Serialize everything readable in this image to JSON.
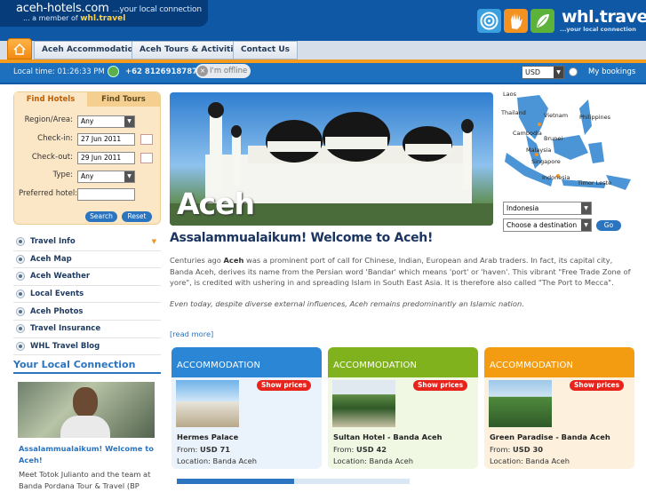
{
  "header": {
    "site_name": "aceh-hotels.com",
    "tagline": "...your local connection",
    "member_prefix": "... a member of",
    "member_brand": "whl.travel",
    "whl_logo": "whl.travel",
    "whl_tagline": "...your local connection"
  },
  "nav": {
    "items": [
      "Aceh Accommodation",
      "Aceh Tours & Activities",
      "Contact Us"
    ]
  },
  "infobar": {
    "local_time": "Local time: 01:26:33 PM",
    "phone": "+62 8126918787",
    "status": "I'm offline",
    "currency": "USD",
    "bookings": "My bookings"
  },
  "search": {
    "tabs": [
      "Find Hotels",
      "Find Tours"
    ],
    "region_label": "Region/Area:",
    "region_value": "Any",
    "checkin_label": "Check-in:",
    "checkin_value": "27 Jun 2011",
    "checkout_label": "Check-out:",
    "checkout_value": "29 Jun 2011",
    "type_label": "Type:",
    "type_value": "Any",
    "preferred_label": "Preferred hotel:",
    "search_btn": "Search",
    "reset_btn": "Reset"
  },
  "menu": [
    "Travel Info",
    "Aceh Map",
    "Aceh Weather",
    "Local Events",
    "Aceh Photos",
    "Travel Insurance",
    "WHL Travel Blog"
  ],
  "local": {
    "title": "Your Local Connection",
    "welcome_line1": "Assalammualaikum! Welcome to",
    "welcome_line2": "Aceh!",
    "text_line1": "Meet Totok Julianto and the team at",
    "text_line2": "Banda Pordana Tour & Travel (BP"
  },
  "hero": {
    "caption": "Aceh"
  },
  "map": {
    "labels": [
      "Laos",
      "Thailand",
      "Vietnam",
      "Philippines",
      "Cambodia",
      "Brunei",
      "Malaysia",
      "Singapore",
      "Indonesia",
      "Timor Leste"
    ],
    "country_select": "Indonesia",
    "destination_select": "Choose a destination",
    "go_btn": "Go"
  },
  "main": {
    "heading": "Assalammualaikum! Welcome to Aceh!",
    "p1_pre": "Centuries ago ",
    "p1_bold": "Aceh",
    "p1_post": " was a prominent port of call for Chinese, Indian, European and Arab traders. In fact, its capital city, Banda Aceh, derives its name from the Persian word 'Bandar' which means 'port' or 'haven'. This vibrant \"Free Trade Zone of yore\", is credited with ushering in and spreading Islam in South East Asia. It is therefore also called \"The Port to Mecca\".",
    "p2": "Even today, despite diverse external influences, Aceh remains predominantly an Islamic nation.",
    "read_more": "[read more]"
  },
  "cards": [
    {
      "header": "ACCOMMODATION",
      "show_prices": "Show prices",
      "name": "Hermes Palace",
      "from_label": "From:",
      "price": "USD 71",
      "location": "Location: Banda Aceh",
      "color": "#2b86d6"
    },
    {
      "header": "ACCOMMODATION",
      "show_prices": "Show prices",
      "name": "Sultan Hotel - Banda Aceh",
      "from_label": "From:",
      "price": "USD 42",
      "location": "Location: Banda Aceh",
      "color": "#7fb21c"
    },
    {
      "header": "ACCOMMODATION",
      "show_prices": "Show prices",
      "name": "Green Paradise - Banda Aceh",
      "from_label": "From:",
      "price": "USD 30",
      "location": "Location: Banda Aceh",
      "color": "#f39c12"
    }
  ]
}
